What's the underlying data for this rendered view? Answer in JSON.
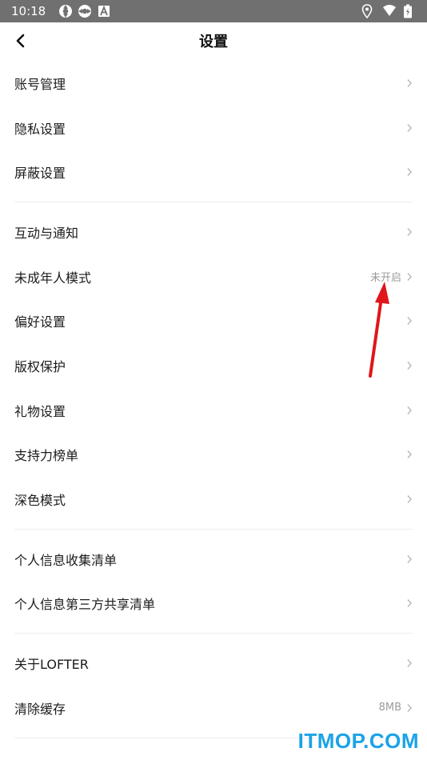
{
  "status_bar": {
    "time": "10:18",
    "left_icons": [
      "sync-icon",
      "sync-icon",
      "app-a-icon"
    ],
    "right_icons": [
      "location-icon",
      "wifi-icon",
      "battery-icon"
    ]
  },
  "header": {
    "title": "设置",
    "back_icon": "chevron-left-icon"
  },
  "groups": [
    {
      "items": [
        {
          "label": "账号管理",
          "value": ""
        },
        {
          "label": "隐私设置",
          "value": ""
        },
        {
          "label": "屏蔽设置",
          "value": ""
        }
      ]
    },
    {
      "items": [
        {
          "label": "互动与通知",
          "value": ""
        },
        {
          "label": "未成年人模式",
          "value": "未开启"
        },
        {
          "label": "偏好设置",
          "value": ""
        },
        {
          "label": "版权保护",
          "value": ""
        },
        {
          "label": "礼物设置",
          "value": ""
        },
        {
          "label": "支持力榜单",
          "value": ""
        },
        {
          "label": "深色模式",
          "value": ""
        }
      ]
    },
    {
      "items": [
        {
          "label": "个人信息收集清单",
          "value": ""
        },
        {
          "label": "个人信息第三方共享清单",
          "value": ""
        }
      ]
    },
    {
      "items": [
        {
          "label": "关于LOFTER",
          "value": ""
        },
        {
          "label": "清除缓存",
          "value": "8MB"
        }
      ]
    }
  ],
  "watermark": "ITMOP.COM",
  "colors": {
    "status_bar_bg": "#707070",
    "annotation_arrow": "#e0161b",
    "watermark": "#1aa3e8",
    "chevron": "#b8b8b8"
  }
}
